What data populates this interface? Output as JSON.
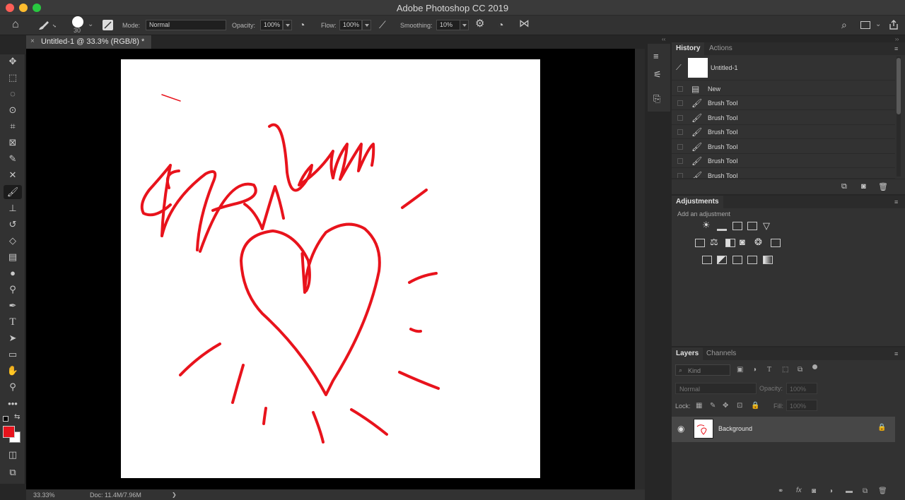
{
  "window": {
    "title": "Adobe Photoshop CC 2019",
    "colors": {
      "close": "#fe5f57",
      "minimize": "#febc2e",
      "zoom": "#28c840"
    }
  },
  "options": {
    "brush_size": "30",
    "mode_label": "Mode:",
    "mode_value": "Normal",
    "opacity_label": "Opacity:",
    "opacity_value": "100%",
    "flow_label": "Flow:",
    "flow_value": "100%",
    "smoothing_label": "Smoothing:",
    "smoothing_value": "10%"
  },
  "document": {
    "tab_title": "Untitled-1 @ 33.3% (RGB/8) *",
    "tab_close": "×",
    "zoom": "33.33%",
    "doc_info": "Doc: 11.4M/7.96M",
    "status_arrow": "❯",
    "brush_color": "#e8131c",
    "background_color": "#ffffff"
  },
  "tools": {
    "foreground_color": "#e8131c",
    "background_color": "#ffffff"
  },
  "history": {
    "tabs": [
      "History",
      "Actions"
    ],
    "snapshot": "Untitled-1",
    "items": [
      "New",
      "Brush Tool",
      "Brush Tool",
      "Brush Tool",
      "Brush Tool",
      "Brush Tool",
      "Brush Tool"
    ]
  },
  "adjustments": {
    "title": "Adjustments",
    "subtitle": "Add an adjustment"
  },
  "layers": {
    "tabs": [
      "Layers",
      "Channels"
    ],
    "filter": "Kind",
    "blend_mode": "Normal",
    "opacity_label": "Opacity:",
    "opacity_value": "100%",
    "lock_label": "Lock:",
    "fill_label": "Fill:",
    "fill_value": "100%",
    "layer_name": "Background",
    "fx_label": "fx"
  }
}
